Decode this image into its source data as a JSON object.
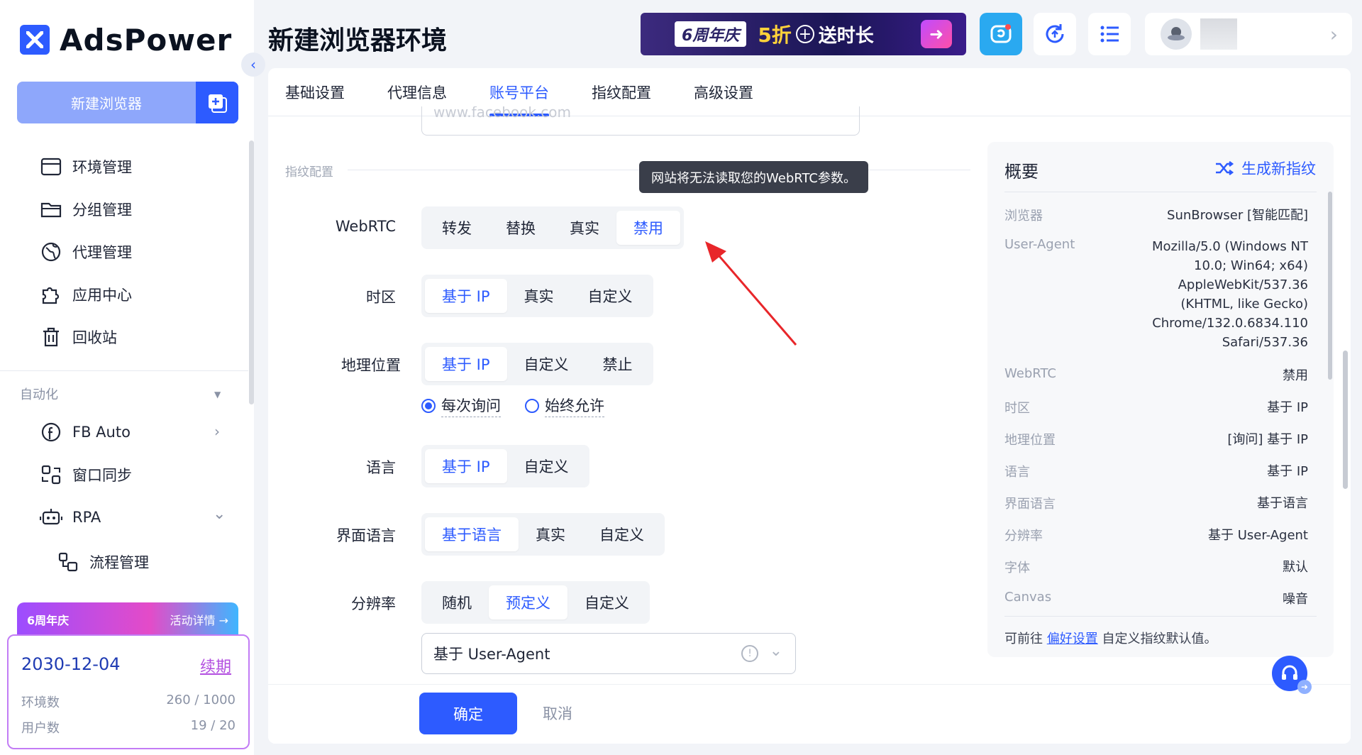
{
  "app": {
    "name": "AdsPower",
    "page_title": "新建浏览器环境"
  },
  "sidebar": {
    "new_browser": "新建浏览器",
    "items": [
      {
        "label": "环境管理",
        "icon": "browser-window-icon"
      },
      {
        "label": "分组管理",
        "icon": "folder-icon"
      },
      {
        "label": "代理管理",
        "icon": "globe-icon"
      },
      {
        "label": "应用中心",
        "icon": "puzzle-icon"
      },
      {
        "label": "回收站",
        "icon": "trash-icon"
      }
    ],
    "automation_title": "自动化",
    "automation": [
      {
        "label": "FB Auto",
        "icon": "facebook-icon"
      },
      {
        "label": "窗口同步",
        "icon": "sync-icon"
      },
      {
        "label": "RPA",
        "icon": "robot-icon"
      }
    ],
    "rpa_sub": {
      "label": "流程管理",
      "icon": "flow-icon"
    },
    "promo": {
      "title": "6周年庆",
      "details": "活动详情 →",
      "date": "2030-12-04",
      "renew": "续期",
      "env_label": "环境数",
      "env_value": "260 / 1000",
      "user_label": "用户数",
      "user_value": "19 / 20"
    }
  },
  "header": {
    "banner": {
      "badge": "6周年庆",
      "discount": "5折",
      "plus": "+",
      "gift": "送时长"
    }
  },
  "tabs": [
    "基础设置",
    "代理信息",
    "账号平台",
    "指纹配置",
    "高级设置"
  ],
  "active_tab": 2,
  "form": {
    "url_placeholder": "www.facebook.com",
    "section_title": "指纹配置",
    "tooltip": "网站将无法读取您的WebRTC参数。",
    "webrtc": {
      "label": "WebRTC",
      "options": [
        "转发",
        "替换",
        "真实",
        "禁用"
      ],
      "selected": "禁用"
    },
    "timezone": {
      "label": "时区",
      "options": [
        "基于 IP",
        "真实",
        "自定义"
      ],
      "selected": "基于 IP"
    },
    "geo": {
      "label": "地理位置",
      "options": [
        "基于 IP",
        "自定义",
        "禁止"
      ],
      "selected": "基于 IP",
      "radio": [
        "每次询问",
        "始终允许"
      ],
      "radio_selected": "每次询问"
    },
    "language": {
      "label": "语言",
      "options": [
        "基于 IP",
        "自定义"
      ],
      "selected": "基于 IP"
    },
    "ui_language": {
      "label": "界面语言",
      "options": [
        "基于语言",
        "真实",
        "自定义"
      ],
      "selected": "基于语言"
    },
    "resolution": {
      "label": "分辨率",
      "options": [
        "随机",
        "预定义",
        "自定义"
      ],
      "selected": "预定义",
      "select_value": "基于 User-Agent"
    }
  },
  "footer": {
    "ok": "确定",
    "cancel": "取消"
  },
  "summary": {
    "title": "概要",
    "generate": "生成新指纹",
    "rows": [
      {
        "k": "浏览器",
        "v": "SunBrowser [智能匹配]"
      },
      {
        "k": "User-Agent",
        "v": "Mozilla/5.0 (Windows NT 10.0; Win64; x64) AppleWebKit/537.36 (KHTML, like Gecko) Chrome/132.0.6834.110 Safari/537.36"
      },
      {
        "k": "WebRTC",
        "v": "禁用"
      },
      {
        "k": "时区",
        "v": "基于 IP"
      },
      {
        "k": "地理位置",
        "v": "[询问] 基于 IP"
      },
      {
        "k": "语言",
        "v": "基于 IP"
      },
      {
        "k": "界面语言",
        "v": "基于语言"
      },
      {
        "k": "分辨率",
        "v": "基于 User-Agent"
      },
      {
        "k": "字体",
        "v": "默认"
      },
      {
        "k": "Canvas",
        "v": "噪音"
      }
    ],
    "note_pre": "可前往",
    "note_link": "偏好设置",
    "note_post": "自定义指纹默认值。"
  },
  "colors": {
    "accent": "#2d5bff",
    "annotation_arrow": "#e8262a"
  }
}
